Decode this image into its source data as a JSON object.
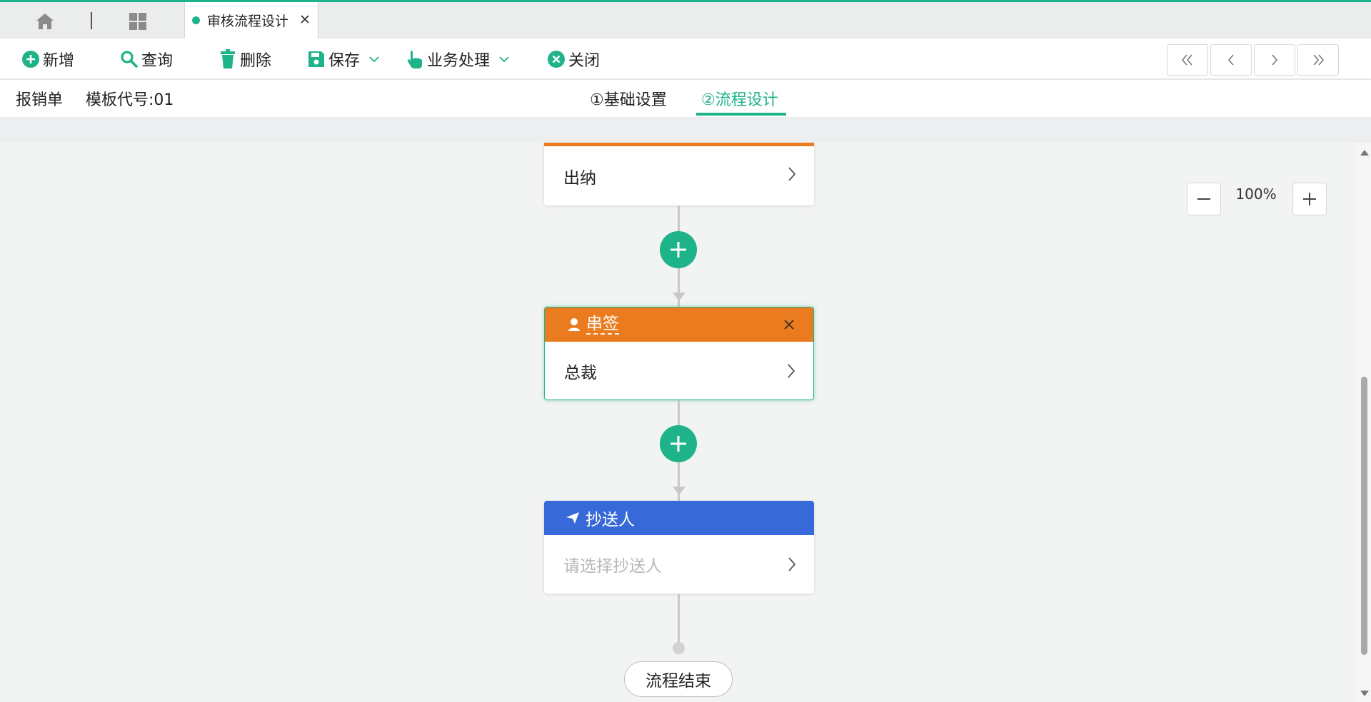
{
  "colors": {
    "accent": "#1fb38a",
    "approver_header": "#ea7c1f",
    "cc_header": "#3769d8",
    "line": "#c8c8c8"
  },
  "tabs": {
    "home_icon": "home-icon",
    "apps_icon": "grid-icon",
    "active_label": "审核流程设计"
  },
  "toolbar": {
    "add_label": "新增",
    "query_label": "查询",
    "delete_label": "删除",
    "save_label": "保存",
    "business_label": "业务处理",
    "close_label": "关闭"
  },
  "info": {
    "form_name": "报销单",
    "template_code": "模板代号:01"
  },
  "steps": [
    {
      "label": "①基础设置",
      "active": false
    },
    {
      "label": "②流程设计",
      "active": true
    }
  ],
  "zoom": {
    "value": "100%"
  },
  "flow": {
    "node_cashier": {
      "body": "出纳"
    },
    "node_approver": {
      "header": "串签",
      "body": "总裁"
    },
    "node_cc": {
      "header": "抄送人",
      "placeholder": "请选择抄送人"
    },
    "end_label": "流程结束"
  }
}
